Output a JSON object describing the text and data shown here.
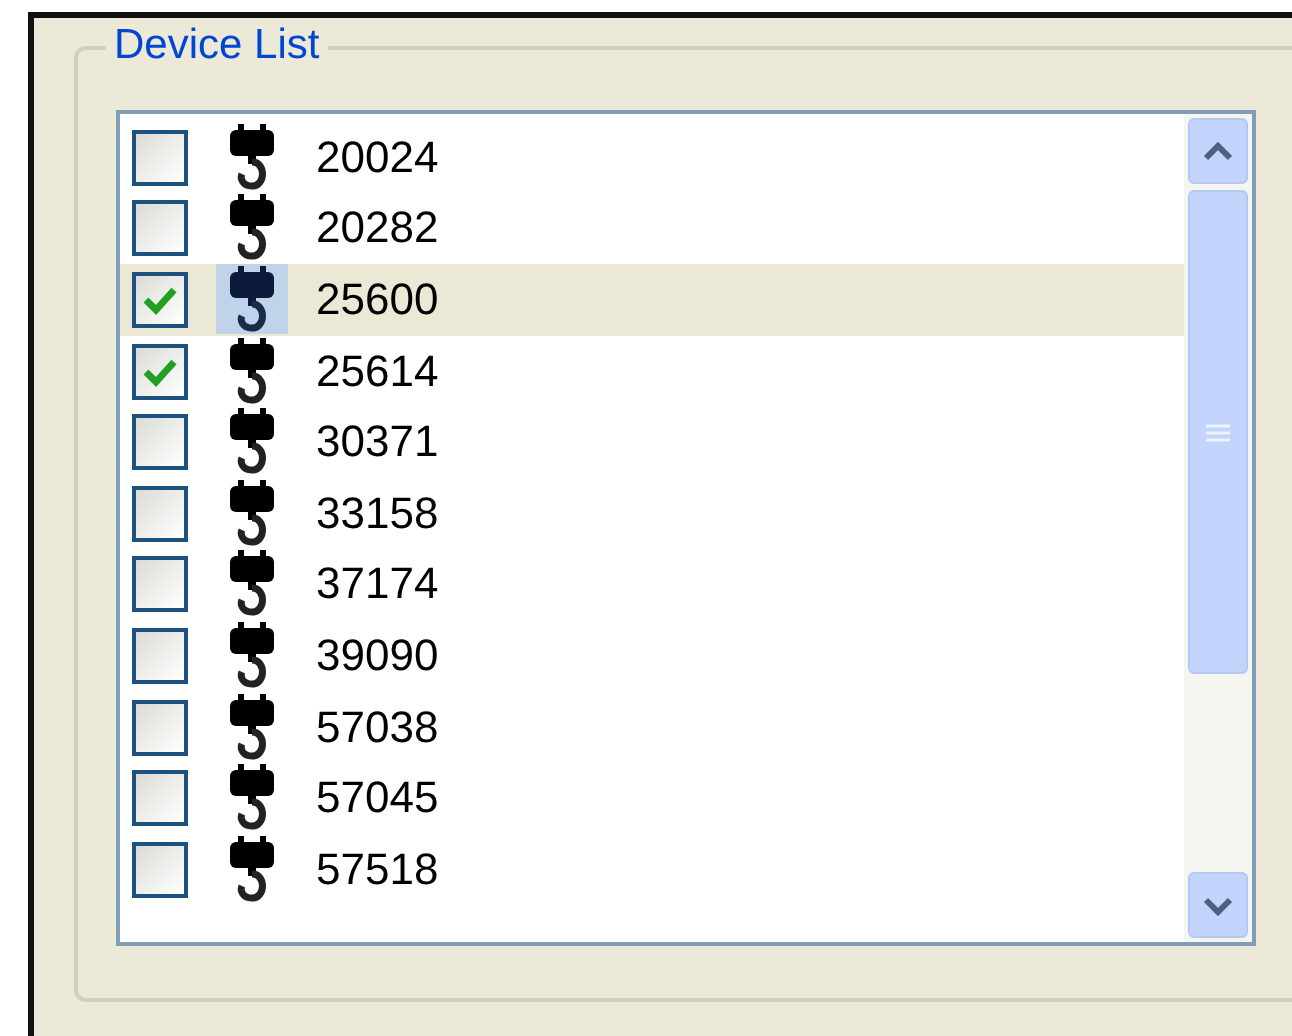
{
  "group": {
    "title": "Device List"
  },
  "devices": [
    {
      "label": "20024",
      "checked": false,
      "selected": false
    },
    {
      "label": "20282",
      "checked": false,
      "selected": false
    },
    {
      "label": "25600",
      "checked": true,
      "selected": true
    },
    {
      "label": "25614",
      "checked": true,
      "selected": false
    },
    {
      "label": "30371",
      "checked": false,
      "selected": false
    },
    {
      "label": "33158",
      "checked": false,
      "selected": false
    },
    {
      "label": "37174",
      "checked": false,
      "selected": false
    },
    {
      "label": "39090",
      "checked": false,
      "selected": false
    },
    {
      "label": "57038",
      "checked": false,
      "selected": false
    },
    {
      "label": "57045",
      "checked": false,
      "selected": false
    },
    {
      "label": "57518",
      "checked": false,
      "selected": false
    }
  ]
}
